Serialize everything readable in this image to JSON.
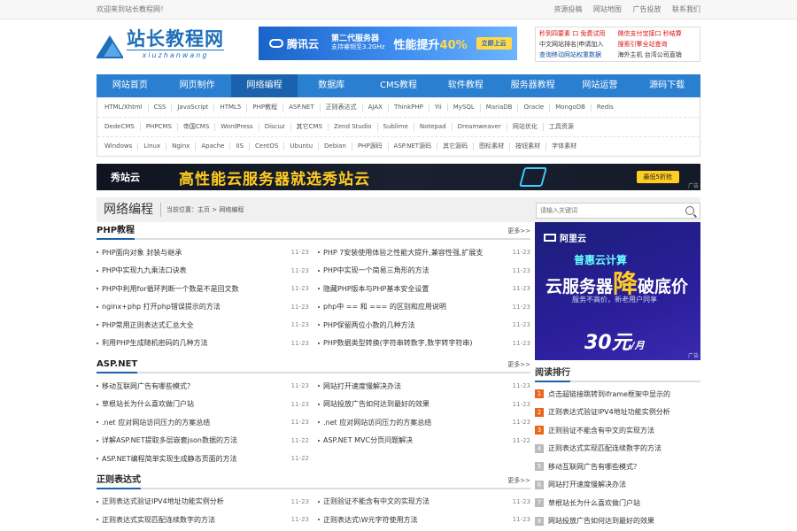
{
  "topbar": {
    "welcome": "欢迎来到站长教程网！",
    "links": [
      "资源投稿",
      "网站地图",
      "广告投放",
      "联系我们"
    ]
  },
  "logo": {
    "cn": "站长教程网",
    "en": "xiuzhanwang"
  },
  "header_ad": {
    "brand": "腾讯云",
    "line1": "第二代服务器",
    "line2": "支持睿频至3.2GHz",
    "headline": "性能提升",
    "percent": "40%",
    "button": "立即上云"
  },
  "header_links": [
    {
      "text": "秒到四要素 口 免费试用",
      "color": "#d11"
    },
    {
      "text": "微信支付宝接口 秒结算",
      "color": "#d11"
    },
    {
      "text": "中文网站排名|申请加入",
      "color": "#333"
    },
    {
      "text": "搜索引擎全站查询",
      "color": "#d11"
    },
    {
      "text": "查询移动网站权重数据",
      "color": "#1a4fa0"
    },
    {
      "text": "海外主机 台湾公司直销",
      "color": "#333"
    }
  ],
  "nav": [
    "网站首页",
    "网页制作",
    "网络编程",
    "数据库",
    "CMS教程",
    "软件教程",
    "服务器教程",
    "网站运营",
    "源码下载"
  ],
  "nav_active": 2,
  "subnav": [
    [
      "HTML/Xhtml",
      "CSS",
      "JavaScript",
      "HTML5",
      "PHP教程",
      "ASP.NET",
      "正则表达式",
      "AJAX",
      "ThinkPHP",
      "Yii",
      "MySQL",
      "MariaDB",
      "Oracle",
      "MongoDB",
      "Redis"
    ],
    [
      "DedeCMS",
      "PHPCMS",
      "帝国CMS",
      "WordPress",
      "Discuz",
      "其它CMS",
      "Zend Studio",
      "Sublime",
      "Notepad",
      "Dreamweaver",
      "网站优化",
      "工具资源"
    ],
    [
      "Windows",
      "Linux",
      "Nginx",
      "Apache",
      "IIS",
      "CentOS",
      "Ubuntu",
      "Debian",
      "PHP源码",
      "ASP.NET源码",
      "其它源码",
      "图标素材",
      "按钮素材",
      "字体素材"
    ]
  ],
  "banner": {
    "brand": "秀站云",
    "headline": "高性能云服务器就选秀站云",
    "button": "最低5折抢",
    "tag": "广告"
  },
  "category": {
    "title": "网络编程",
    "crumb": "当前位置：主页 > 网络编程"
  },
  "search": {
    "placeholder": "请输入关键词"
  },
  "sections": [
    {
      "title": "PHP教程",
      "more": "更多>>",
      "items": [
        {
          "text": "PHP面向对象 封装与继承",
          "date": "11-23"
        },
        {
          "text": "PHP 7安装使用体验之性能大提升,兼容性强,扩展支",
          "date": "11-23"
        },
        {
          "text": "PHP中实现九九乘法口诀表",
          "date": "11-23"
        },
        {
          "text": "PHP中实现一个简易三角形的方法",
          "date": "11-23"
        },
        {
          "text": "PHP中利用for循环判断一个数是不是回文数",
          "date": "11-23"
        },
        {
          "text": "隐藏PHP版本与PHP基本安全设置",
          "date": "11-23"
        },
        {
          "text": "nginx+php 打开php错误提示的方法",
          "date": "11-23"
        },
        {
          "text": "php中 == 和 === 的区别和应用说明",
          "date": "11-23"
        },
        {
          "text": "PHP常用正则表达式汇总大全",
          "date": "11-23"
        },
        {
          "text": "PHP保留两位小数的几种方法",
          "date": "11-23"
        },
        {
          "text": "利用PHP生成随机密码的几种方法",
          "date": "11-23"
        },
        {
          "text": "PHP数据类型转换(字符串转数字,数字转字符串)",
          "date": "11-23"
        }
      ]
    },
    {
      "title": "ASP.NET",
      "more": "更多>>",
      "items": [
        {
          "text": "移动互联网广告有哪些模式？",
          "date": "11-23"
        },
        {
          "text": "网站打开速度慢解决办法",
          "date": "11-23"
        },
        {
          "text": "草根站长为什么喜欢做门户站",
          "date": "11-23"
        },
        {
          "text": "网站投放广告如何达到最好的效果",
          "date": "11-23"
        },
        {
          "text": ".net 应对网站访问压力的方案总结",
          "date": "11-23"
        },
        {
          "text": ".net 应对网站访问压力的方案总结",
          "date": "11-23"
        },
        {
          "text": "详解ASP.NET提取多层嵌套json数据的方法",
          "date": "11-22"
        },
        {
          "text": "ASP.NET MVC分页问题解决",
          "date": "11-22"
        },
        {
          "text": "ASP.NET编程简单实现生成静态页面的方法",
          "date": "11-22"
        }
      ]
    },
    {
      "title": "正则表达式",
      "more": "更多>>",
      "items": [
        {
          "text": "正则表达式验证IPV4地址功能实例分析",
          "date": "11-23"
        },
        {
          "text": "正则验证不能含有中文的实现方法",
          "date": "11-23"
        },
        {
          "text": "正则表达式实现匹配连续数字的方法",
          "date": "11-23"
        },
        {
          "text": "正则表达式\\W元字符使用方法",
          "date": "11-23"
        }
      ]
    }
  ],
  "side_ad": {
    "brand": "阿里云",
    "line1": "普惠云计算",
    "line2": "云服务器",
    "line2_big": "降",
    "line2_end": "破底价",
    "line3": "服务不高价，新老用户同享",
    "price": "30元",
    "price_unit": "/月",
    "tag": "广告"
  },
  "rank": {
    "title": "阅读排行",
    "items": [
      "点击超链接跳转到iframe框架中显示的",
      "正则表达式验证IPV4地址功能实例分析",
      "正则验证不能含有中文的实现方法",
      "正则表达式实现匹配连续数字的方法",
      "移动互联网广告有哪些模式？",
      "网站打开速度慢解决办法",
      "草根站长为什么喜欢做门户站",
      "网站投放广告如何达到最好的效果"
    ]
  }
}
